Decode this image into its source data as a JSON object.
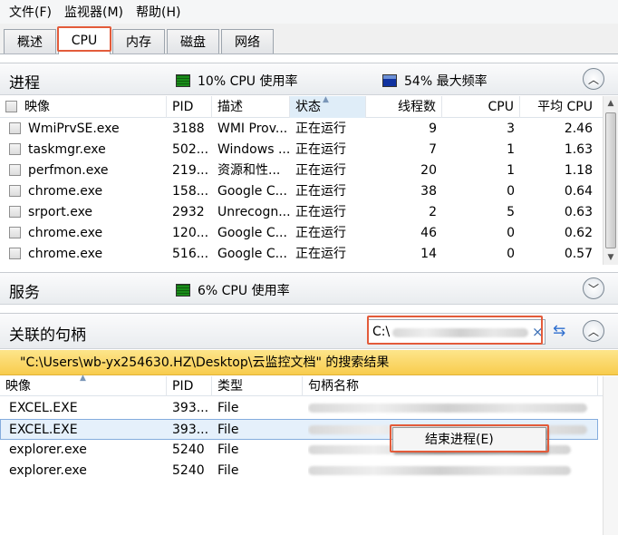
{
  "menu": [
    "文件(F)",
    "监视器(M)",
    "帮助(H)"
  ],
  "tabs": [
    "概述",
    "CPU",
    "内存",
    "磁盘",
    "网络"
  ],
  "process_section": {
    "title": "进程",
    "cpu_meter": "10% CPU 使用率",
    "freq_meter": "54% 最大频率",
    "columns": [
      "映像",
      "PID",
      "描述",
      "状态",
      "线程数",
      "CPU",
      "平均 CPU"
    ],
    "rows": [
      {
        "image": "WmiPrvSE.exe",
        "pid": "3188",
        "desc": "WMI Prov...",
        "status": "正在运行",
        "threads": "9",
        "cpu": "3",
        "avg": "2.46"
      },
      {
        "image": "taskmgr.exe",
        "pid": "502...",
        "desc": "Windows ...",
        "status": "正在运行",
        "threads": "7",
        "cpu": "1",
        "avg": "1.63"
      },
      {
        "image": "perfmon.exe",
        "pid": "219...",
        "desc": "资源和性...",
        "status": "正在运行",
        "threads": "20",
        "cpu": "1",
        "avg": "1.18"
      },
      {
        "image": "chrome.exe",
        "pid": "158...",
        "desc": "Google C...",
        "status": "正在运行",
        "threads": "38",
        "cpu": "0",
        "avg": "0.64"
      },
      {
        "image": "srport.exe",
        "pid": "2932",
        "desc": "Unrecogn...",
        "status": "正在运行",
        "threads": "2",
        "cpu": "5",
        "avg": "0.63"
      },
      {
        "image": "chrome.exe",
        "pid": "120...",
        "desc": "Google C...",
        "status": "正在运行",
        "threads": "46",
        "cpu": "0",
        "avg": "0.62"
      },
      {
        "image": "chrome.exe",
        "pid": "516...",
        "desc": "Google C...",
        "status": "正在运行",
        "threads": "14",
        "cpu": "0",
        "avg": "0.57"
      }
    ]
  },
  "services_section": {
    "title": "服务",
    "cpu_meter": "6% CPU 使用率"
  },
  "handles_section": {
    "title": "关联的句柄",
    "search_value": "C:\\",
    "search_clear": "×",
    "result_text": "\"C:\\Users\\wb-yx254630.HZ\\Desktop\\云监控文档\" 的搜索结果",
    "columns": [
      "映像",
      "PID",
      "类型",
      "句柄名称"
    ],
    "rows": [
      {
        "image": "EXCEL.EXE",
        "pid": "393...",
        "type": "File"
      },
      {
        "image": "EXCEL.EXE",
        "pid": "393...",
        "type": "File"
      },
      {
        "image": "explorer.exe",
        "pid": "5240",
        "type": "File"
      },
      {
        "image": "explorer.exe",
        "pid": "5240",
        "type": "File"
      }
    ]
  },
  "context_menu": {
    "item": "结束进程(E)"
  },
  "colors": {
    "highlight": "#e35b3a",
    "selected_row": "#e5f0fb",
    "result_bar": "#f8cc4d"
  }
}
